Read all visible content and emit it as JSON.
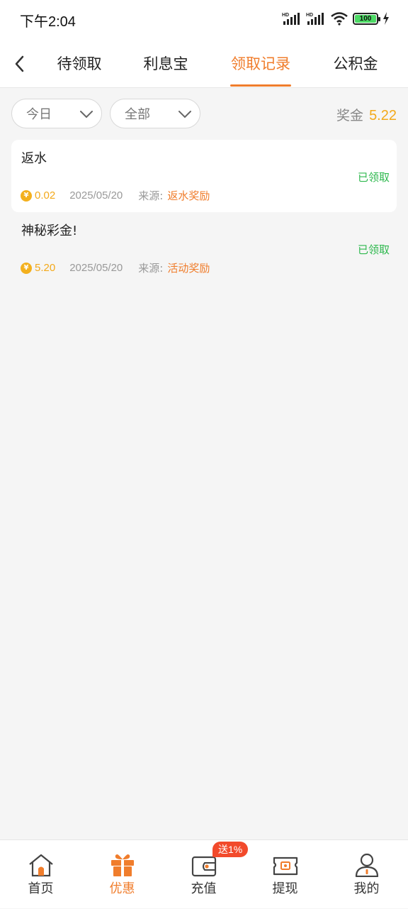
{
  "status_bar": {
    "time": "下午2:04",
    "battery": "100"
  },
  "nav": {
    "tabs": [
      {
        "label": "待领取"
      },
      {
        "label": "利息宝"
      },
      {
        "label": "领取记录"
      },
      {
        "label": "公积金"
      }
    ],
    "active_tab": "领取记录"
  },
  "filters": {
    "date": "今日",
    "type": "全部"
  },
  "bonus": {
    "label": "奖金",
    "value": "5.22"
  },
  "records": [
    {
      "title": "返水",
      "status": "已领取",
      "currency_icon": "¥",
      "amount": "0.02",
      "date": "2025/05/20",
      "source_label": "来源:",
      "source": "返水奖励"
    },
    {
      "title": "神秘彩金!",
      "status": "已领取",
      "currency_icon": "¥",
      "amount": "5.20",
      "date": "2025/05/20",
      "source_label": "来源:",
      "source": "活动奖励"
    }
  ],
  "bottom_nav": {
    "items": [
      {
        "label": "首页",
        "icon": "home-icon"
      },
      {
        "label": "优惠",
        "icon": "gift-icon"
      },
      {
        "label": "充值",
        "icon": "wallet-icon"
      },
      {
        "label": "提现",
        "icon": "withdraw-icon"
      },
      {
        "label": "我的",
        "icon": "profile-icon"
      }
    ],
    "active": "优惠",
    "promo_badge": "送1%"
  },
  "colors": {
    "accent": "#f07d2c",
    "gold": "#f3a91a",
    "success": "#2db84d"
  }
}
